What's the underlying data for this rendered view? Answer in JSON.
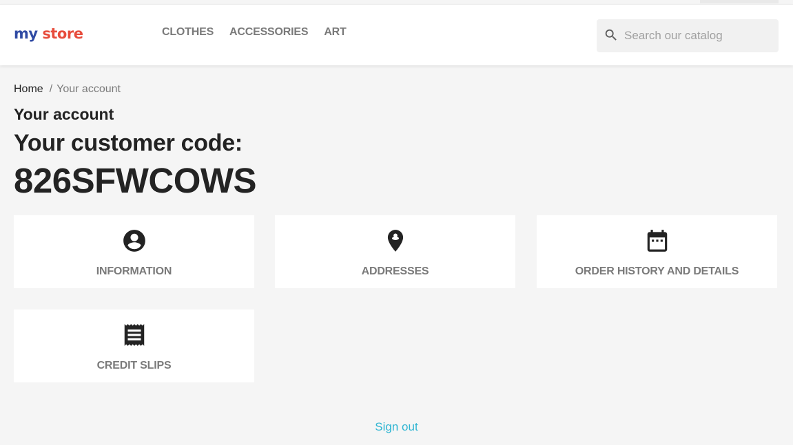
{
  "logo": {
    "part1": "my",
    "part2": "store"
  },
  "nav": {
    "items": [
      {
        "label": "CLOTHES"
      },
      {
        "label": "ACCESSORIES"
      },
      {
        "label": "ART"
      }
    ]
  },
  "search": {
    "placeholder": "Search our catalog",
    "value": "",
    "icon": "search-icon"
  },
  "breadcrumb": {
    "home": "Home",
    "separator": "/",
    "current": "Your account"
  },
  "page": {
    "title": "Your account",
    "customer_code_label": "Your customer code:",
    "customer_code": "826SFWCOWS"
  },
  "cards": [
    {
      "label": "INFORMATION",
      "icon": "account-circle-icon"
    },
    {
      "label": "ADDRESSES",
      "icon": "location-pin-icon"
    },
    {
      "label": "ORDER HISTORY AND DETAILS",
      "icon": "calendar-icon"
    },
    {
      "label": "CREDIT SLIPS",
      "icon": "receipt-icon"
    }
  ],
  "footer": {
    "sign_out": "Sign out"
  },
  "colors": {
    "accent": "#2fb5d2",
    "text": "#232323",
    "muted": "#7a7a7a",
    "background": "#f5f5f5"
  }
}
